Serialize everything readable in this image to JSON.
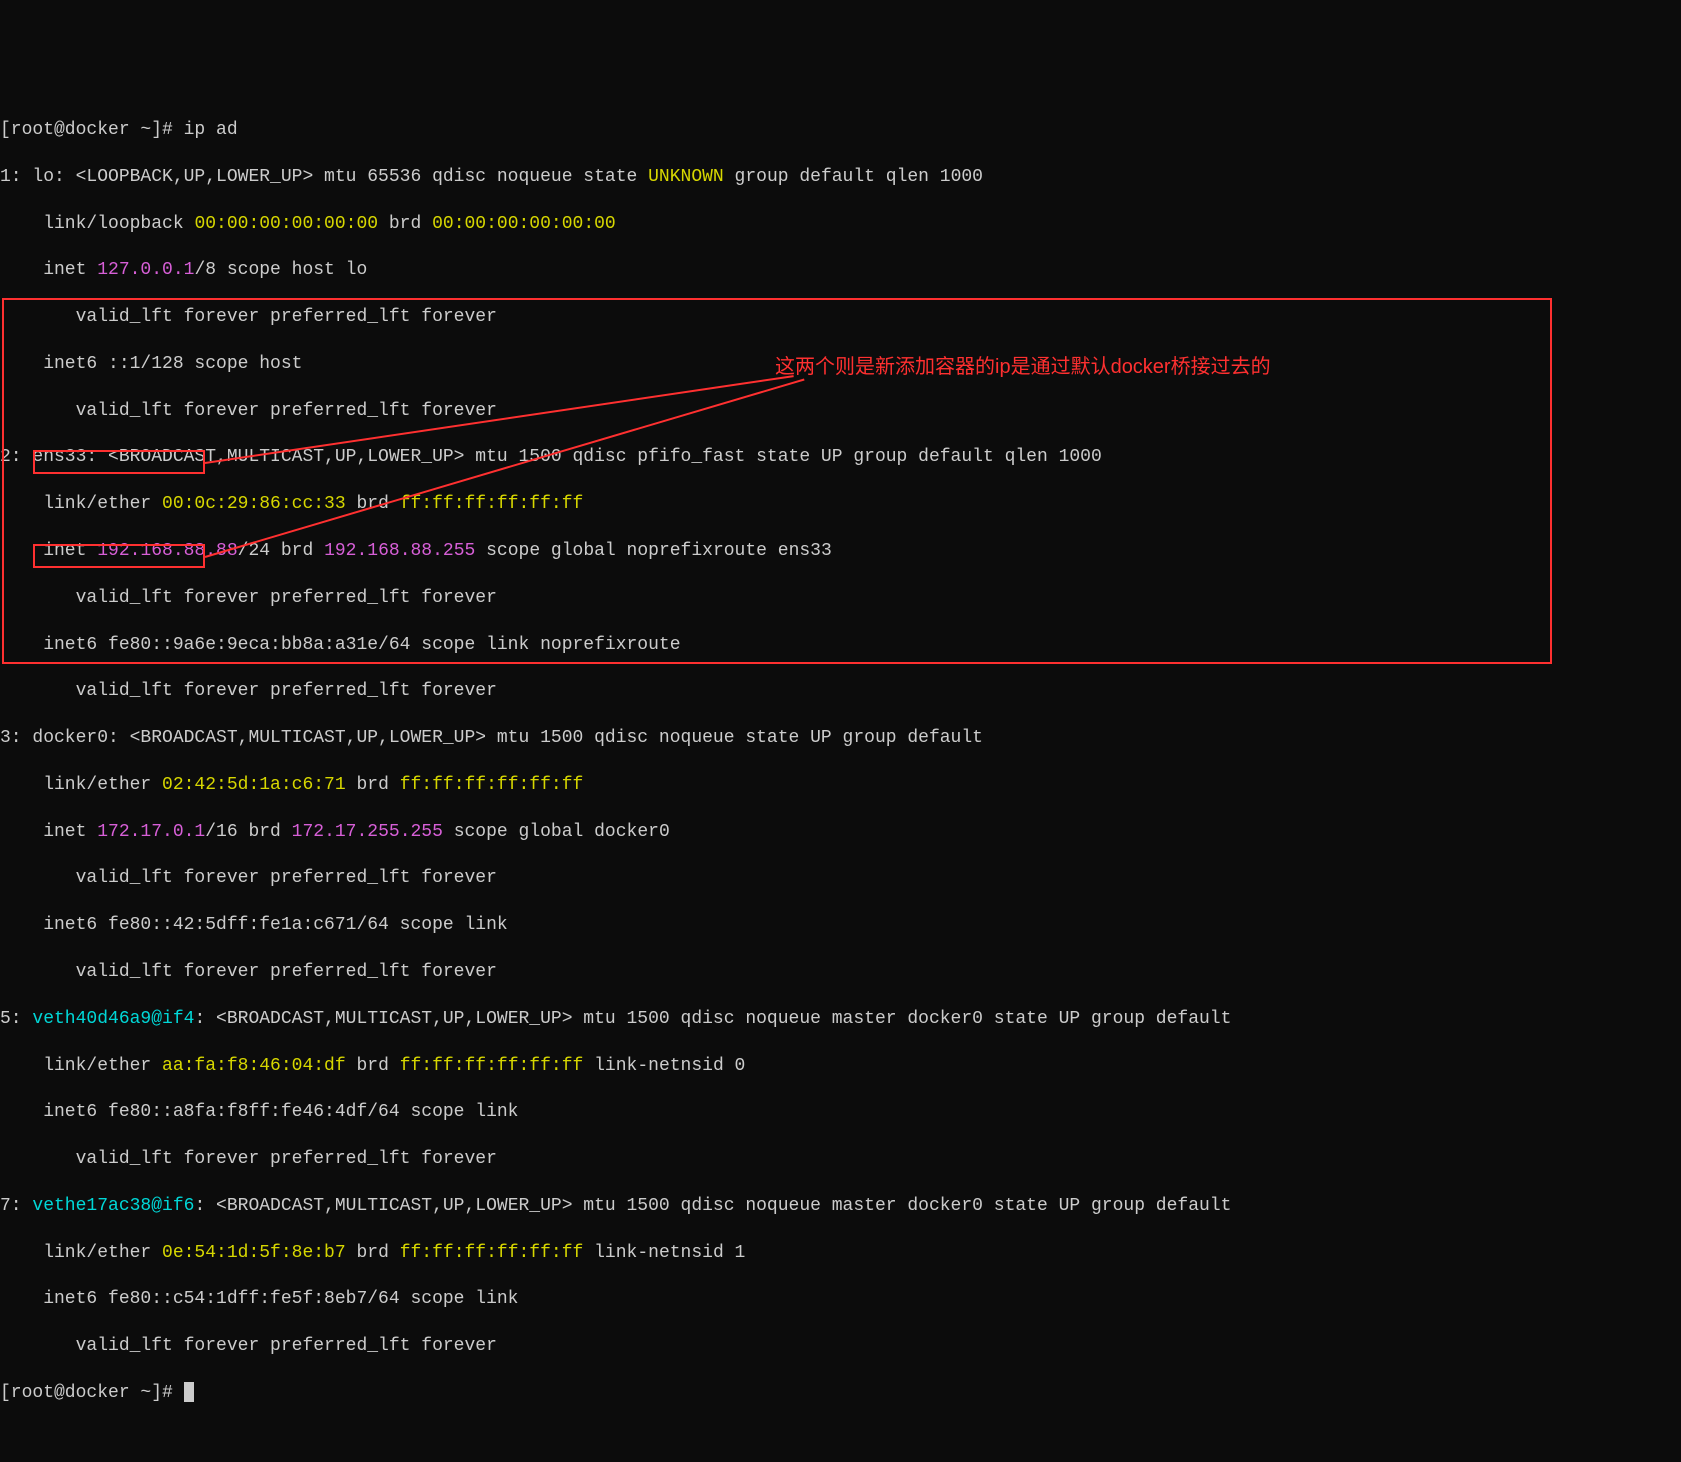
{
  "prompt1": "[root@docker ~]# ip ad",
  "iface1": {
    "header_pre": "1: lo: <LOOPBACK,UP,LOWER_UP> mtu 65536 qdisc noqueue state ",
    "state": "UNKNOWN",
    "header_post": " group default qlen 1000",
    "link_pre": "    link/loopback ",
    "mac1": "00:00:00:00:00:00",
    "link_mid": " brd ",
    "mac2": "00:00:00:00:00:00",
    "inet_pre": "    inet ",
    "ip": "127.0.0.1",
    "inet_post": "/8 scope host lo",
    "valid": "       valid_lft forever preferred_lft forever",
    "inet6": "    inet6 ::1/128 scope host",
    "valid6": "       valid_lft forever preferred_lft forever"
  },
  "iface2": {
    "header": "2: ens33: <BROADCAST,MULTICAST,UP,LOWER_UP> mtu 1500 qdisc pfifo_fast state UP group default qlen 1000",
    "link_pre": "    link/ether ",
    "mac1": "00:0c:29:86:cc:33",
    "link_mid": " brd ",
    "mac2": "ff:ff:ff:ff:ff:ff",
    "inet_pre": "    inet ",
    "ip": "192.168.88.88",
    "inet_mid": "/24 brd ",
    "brd": "192.168.88.255",
    "inet_post": " scope global noprefixroute ens33",
    "valid": "       valid_lft forever preferred_lft forever",
    "inet6": "    inet6 fe80::9a6e:9eca:bb8a:a31e/64 scope link noprefixroute",
    "valid6": "       valid_lft forever preferred_lft forever"
  },
  "iface3": {
    "header": "3: docker0: <BROADCAST,MULTICAST,UP,LOWER_UP> mtu 1500 qdisc noqueue state UP group default",
    "link_pre": "    link/ether ",
    "mac1": "02:42:5d:1a:c6:71",
    "link_mid": " brd ",
    "mac2": "ff:ff:ff:ff:ff:ff",
    "inet_pre": "    inet ",
    "ip": "172.17.0.1",
    "inet_mid": "/16 brd ",
    "brd": "172.17.255.255",
    "inet_post": " scope global docker0",
    "valid": "       valid_lft forever preferred_lft forever",
    "inet6": "    inet6 fe80::42:5dff:fe1a:c671/64 scope link",
    "valid6": "       valid_lft forever preferred_lft forever"
  },
  "iface5": {
    "num": "5: ",
    "name": "veth40d46a9@if4",
    "header_post": ": <BROADCAST,MULTICAST,UP,LOWER_UP> mtu 1500 qdisc noqueue master docker0 state UP group default",
    "link_pre": "    link/ether ",
    "mac1": "aa:fa:f8:46:04:df",
    "link_mid": " brd ",
    "mac2": "ff:ff:ff:ff:ff:ff",
    "link_post": " link-netnsid 0",
    "inet6": "    inet6 fe80::a8fa:f8ff:fe46:4df/64 scope link",
    "valid6": "       valid_lft forever preferred_lft forever"
  },
  "iface7": {
    "num": "7: ",
    "name": "vethe17ac38@if6",
    "header_post": ": <BROADCAST,MULTICAST,UP,LOWER_UP> mtu 1500 qdisc noqueue master docker0 state UP group default",
    "link_pre": "    link/ether ",
    "mac1": "0e:54:1d:5f:8e:b7",
    "link_mid": " brd ",
    "mac2": "ff:ff:ff:ff:ff:ff",
    "link_post": " link-netnsid 1",
    "inet6": "    inet6 fe80::c54:1dff:fe5f:8eb7/64 scope link",
    "valid6": "       valid_lft forever preferred_lft forever"
  },
  "prompt2": "[root@docker ~]# ",
  "annotation": "这两个则是新添加容器的ip是通过默认docker桥接过去的"
}
